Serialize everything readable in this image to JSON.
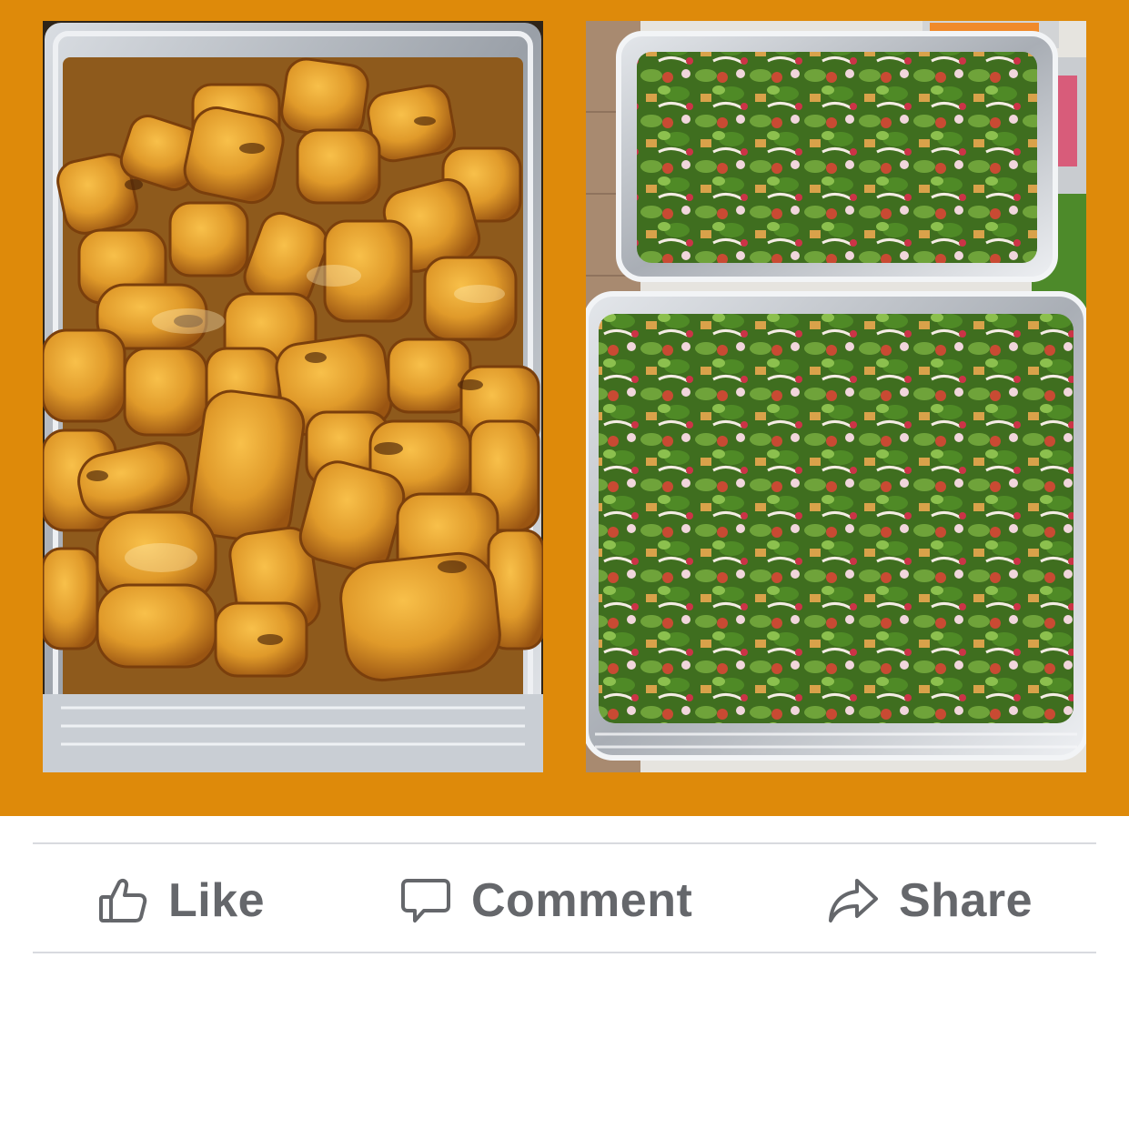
{
  "post": {
    "photos": [
      {
        "subject": "grilled chicken kebab pieces in foil tray"
      },
      {
        "subject": "two foil trays of fattoush salad"
      }
    ]
  },
  "actions": {
    "like_label": "Like",
    "comment_label": "Comment",
    "share_label": "Share",
    "like_icon": "thumbs-up-icon",
    "comment_icon": "speech-bubble-icon",
    "share_icon": "share-arrow-icon"
  },
  "colors": {
    "frame": "#DE8A0A",
    "action_text": "#65676b",
    "divider": "#d8dadf",
    "background": "#ffffff"
  }
}
